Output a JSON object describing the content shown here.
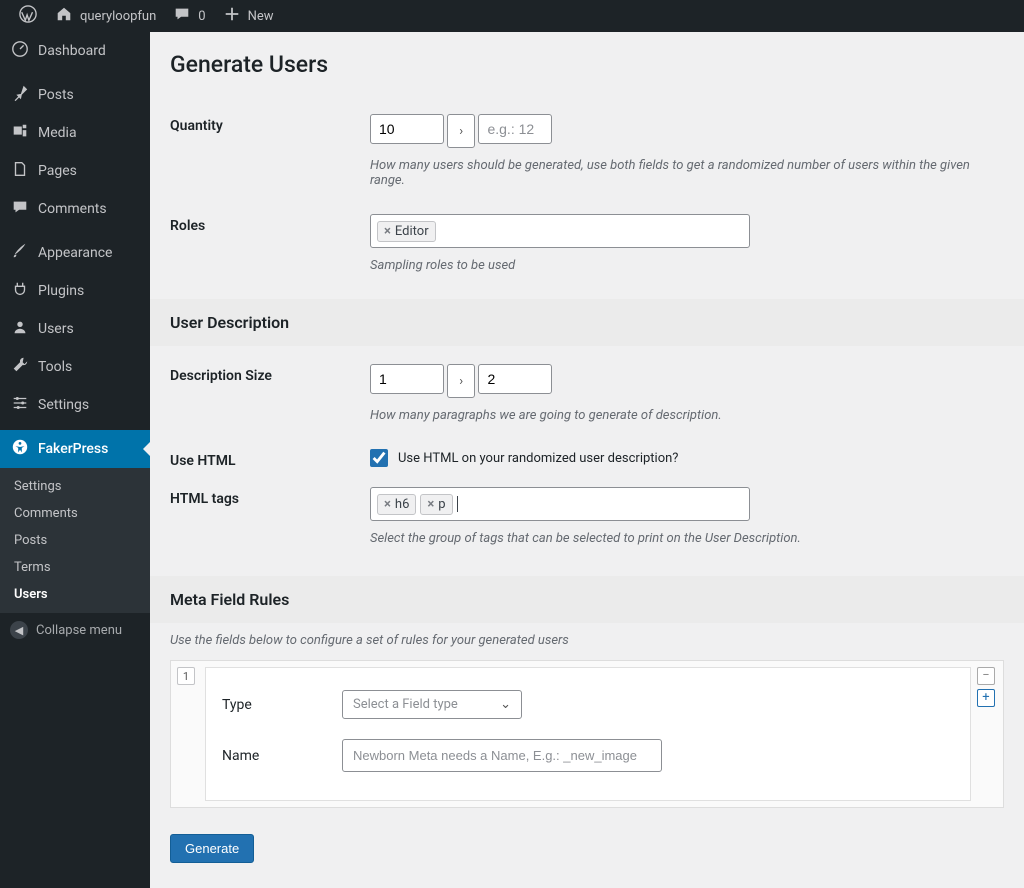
{
  "adminbar": {
    "site_name": "queryloopfun",
    "comments_count": "0",
    "new_label": "New"
  },
  "sidebar": {
    "items": [
      {
        "label": "Dashboard",
        "name": "dashboard"
      },
      {
        "label": "Posts",
        "name": "posts"
      },
      {
        "label": "Media",
        "name": "media"
      },
      {
        "label": "Pages",
        "name": "pages"
      },
      {
        "label": "Comments",
        "name": "comments"
      },
      {
        "label": "Appearance",
        "name": "appearance"
      },
      {
        "label": "Plugins",
        "name": "plugins"
      },
      {
        "label": "Users",
        "name": "users"
      },
      {
        "label": "Tools",
        "name": "tools"
      },
      {
        "label": "Settings",
        "name": "settings"
      },
      {
        "label": "FakerPress",
        "name": "fakerpress",
        "current": true
      }
    ],
    "submenu": [
      {
        "label": "Settings"
      },
      {
        "label": "Comments"
      },
      {
        "label": "Posts"
      },
      {
        "label": "Terms"
      },
      {
        "label": "Users",
        "current": true
      }
    ],
    "collapse_label": "Collapse menu"
  },
  "page": {
    "title": "Generate Users",
    "sections": {
      "quantity": {
        "label": "Quantity",
        "value_min": "10",
        "placeholder_max": "e.g.: 12",
        "help": "How many users should be generated, use both fields to get a randomized number of users within the given range."
      },
      "roles": {
        "label": "Roles",
        "tags": [
          "Editor"
        ],
        "help": "Sampling roles to be used"
      },
      "user_description_title": "User Description",
      "desc_size": {
        "label": "Description Size",
        "value_min": "1",
        "value_max": "2",
        "help": "How many paragraphs we are going to generate of description."
      },
      "use_html": {
        "label": "Use HTML",
        "checked": true,
        "text": "Use HTML on your randomized user description?"
      },
      "html_tags": {
        "label": "HTML tags",
        "tags": [
          "h6",
          "p"
        ],
        "help": "Select the group of tags that can be selected to print on the User Description."
      },
      "meta_title": "Meta Field Rules",
      "meta_help": "Use the fields below to configure a set of rules for your generated users",
      "meta_rule": {
        "index": "1",
        "type_label": "Type",
        "type_placeholder": "Select a Field type",
        "name_label": "Name",
        "name_placeholder": "Newborn Meta needs a Name, E.g.: _new_image"
      },
      "generate_label": "Generate"
    }
  }
}
